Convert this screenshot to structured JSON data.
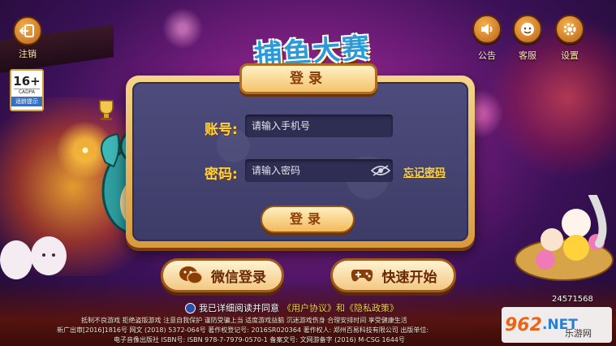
{
  "top_left": {
    "label": "注销",
    "icon": "logout-icon"
  },
  "top_right": [
    {
      "label": "公告",
      "icon": "speaker-icon"
    },
    {
      "label": "客服",
      "icon": "support-face-icon"
    },
    {
      "label": "设置",
      "icon": "gear-icon"
    }
  ],
  "logo": {
    "text": "捕鱼大赛"
  },
  "age_rating": {
    "age": "16+",
    "org": "CADPA",
    "tip": "适龄提示"
  },
  "login_panel": {
    "title": "登录",
    "account_label": "账号:",
    "account_placeholder": "请输入手机号",
    "password_label": "密码:",
    "password_placeholder": "请输入密码",
    "forgot_password": "忘记密码",
    "login_button": "登录"
  },
  "buttons": {
    "wechat_login": "微信登录",
    "quick_start": "快速开始"
  },
  "agreement": {
    "text": "我已详细阅读并同意",
    "link": "《用户协议》和《隐私政策》"
  },
  "legal": {
    "line1": "抵制不良游戏  拒绝盗版游戏  注意自我保护  谨防受骗上当  适度游戏益脑  沉迷游戏伤身  合理安排时间  享受健康生活",
    "line2": "新广出审[2016]1816号  网文 (2018) 5372-064号  著作权登记号: 2016SR020364  著作权人: 郑州百易科技有限公司  出版单位:",
    "line3": "电子音像出版社  ISBN号: ISBN 978-7-7979-0570-1  备案文号: 文网游备字 (2016) M-CSG 1644号"
  },
  "version": "24571568",
  "watermark": {
    "brand": "962",
    "tld": ".NET",
    "sub": "乐游网"
  },
  "colors": {
    "accent_gold": "#ffd23c",
    "panel_purple": "#4d4c7c",
    "button_brown": "#8a3d07"
  }
}
